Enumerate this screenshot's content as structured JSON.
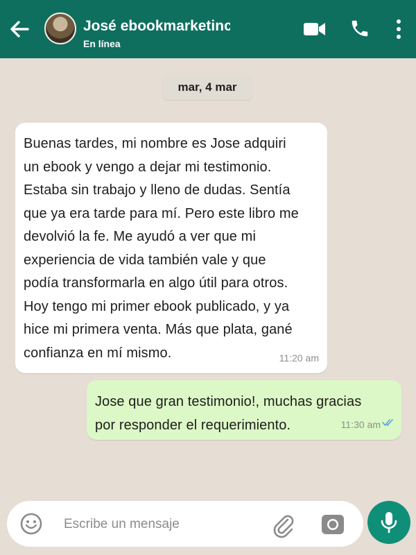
{
  "header": {
    "contact_name": "José ebookmarketinc",
    "status": "En línea",
    "icons": [
      "back-arrow-icon",
      "video-call-icon",
      "phone-icon",
      "more-options-icon"
    ]
  },
  "chat": {
    "date_label": "mar, 4 mar",
    "messages": [
      {
        "direction": "incoming",
        "text": "Buenas tardes, mi nombre es Jose adquiri\nun ebook y vengo a dejar mi testimonio.\nEstaba sin trabajo y lleno de dudas. Sentía\nque ya era tarde para mí. Pero este libro me\ndevolvió la fe. Me ayudó a ver que mi\nexperiencia de vida también vale y que\npodía transformarla en algo útil para otros.\nHoy tengo mi primer ebook publicado, y ya\nhice mi primera venta. Más que plata, gané\nconfianza en mí mismo.",
        "time": "11:20 am"
      },
      {
        "direction": "outgoing",
        "text": "Jose que gran testimonio!, muchas gracias\npor responder el requerimiento.",
        "time": "11:30 am",
        "status": "read"
      }
    ]
  },
  "composer": {
    "placeholder": "Escribe un mensaje",
    "value": ""
  },
  "colors": {
    "header": "#0f6f5f",
    "chat_background": "#e6ddd4",
    "outgoing_bubble": "#dcf8c6",
    "incoming_bubble": "#ffffff",
    "mic_button": "#0f8f77",
    "read_ticks": "#4fa6e0"
  }
}
